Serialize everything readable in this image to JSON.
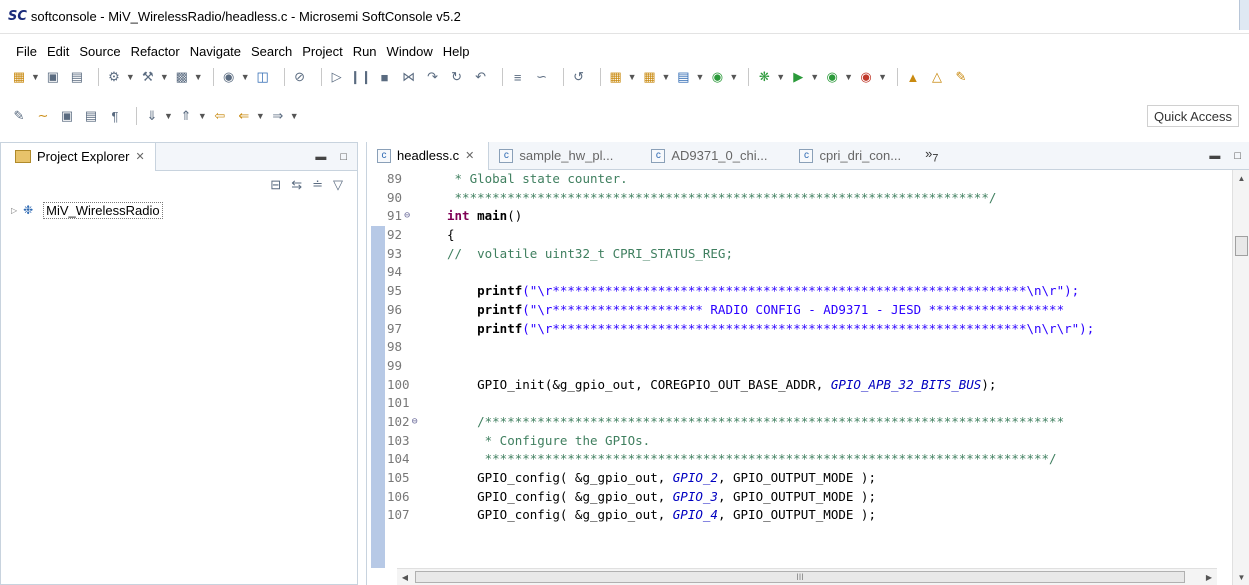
{
  "window": {
    "app_logo": "SC",
    "title": "softconsole - MiV_WirelessRadio/headless.c - Microsemi SoftConsole v5.2"
  },
  "menu": [
    "File",
    "Edit",
    "Source",
    "Refactor",
    "Navigate",
    "Search",
    "Project",
    "Run",
    "Window",
    "Help"
  ],
  "toolbar": {
    "quick_access": "Quick Access"
  },
  "explorer": {
    "tab_label": "Project Explorer",
    "project": "MiV_WirelessRadio"
  },
  "editor": {
    "tabs": [
      {
        "label": "headless.c",
        "active": true
      },
      {
        "label": "sample_hw_pl...",
        "active": false
      },
      {
        "label": "AD9371_0_chi...",
        "active": false
      },
      {
        "label": "cpri_dri_con...",
        "active": false
      }
    ],
    "overflow_count": "7",
    "hscroll_grip": "III",
    "line_numbers": [
      "89",
      "90",
      "91",
      "92",
      "93",
      "94",
      "95",
      "96",
      "97",
      "98",
      "99",
      "100",
      "101",
      "102",
      "103",
      "104",
      "105",
      "106",
      "107"
    ],
    "fold_markers": {
      "91": true,
      "102": true
    },
    "code": {
      "l89": " * Global state counter.",
      "l90": " ***********************************************************************/",
      "l91_kw": "int ",
      "l91_fn": "main",
      "l91_rest": "()",
      "l92": "{",
      "l93": "//  volatile uint32_t CPRI_STATUS_REG;",
      "l94": "",
      "l95_fn": "    printf",
      "l95_str": "(\"\\r***************************************************************\\n\\r\");",
      "l96_fn": "    printf",
      "l96_str": "(\"\\r******************** RADIO CONFIG - AD9371 - JESD ******************",
      "l97_fn": "    printf",
      "l97_str": "(\"\\r***************************************************************\\n\\r\\r\");",
      "l98": "",
      "l99": "",
      "l100_a": "    GPIO_init(&g_gpio_out, COREGPIO_OUT_BASE_ADDR, ",
      "l100_it": "GPIO_APB_32_BITS_BUS",
      "l100_b": ");",
      "l101": "",
      "l102": "    /*****************************************************************************",
      "l103": "     * Configure the GPIOs.",
      "l104": "     ***************************************************************************/",
      "l105_a": "    GPIO_config( &g_gpio_out, ",
      "l105_it": "GPIO_2",
      "l105_b": ", GPIO_OUTPUT_MODE );",
      "l106_a": "    GPIO_config( &g_gpio_out, ",
      "l106_it": "GPIO_3",
      "l106_b": ", GPIO_OUTPUT_MODE );",
      "l107_a": "    GPIO_config( &g_gpio_out, ",
      "l107_it": "GPIO_4",
      "l107_b": ", GPIO_OUTPUT_MODE );"
    }
  },
  "colors": {
    "keyword": "#7f0055",
    "comment": "#3f7f5f",
    "string": "#2a00ff",
    "constant_italic": "#0000c0",
    "ruler_band": "#b7c9e6"
  }
}
